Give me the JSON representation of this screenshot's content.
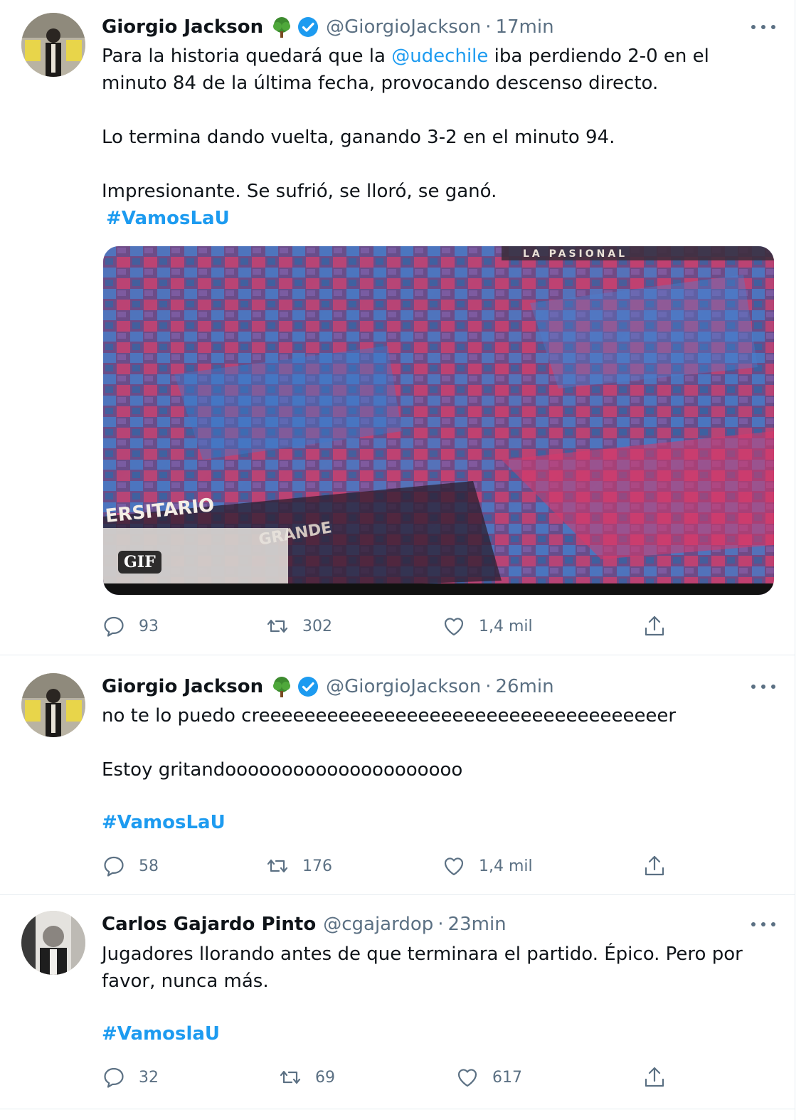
{
  "tweets": [
    {
      "author": "Giorgio Jackson",
      "handle": "@GiorgioJackson",
      "time": "17min",
      "text_parts": {
        "p1_before": "Para la historia quedará que la ",
        "p1_mention": "@udechile",
        "p1_after": " iba perdiendo 2-0 en el minuto 84 de la última fecha, provocando descenso directo.",
        "p2": "Lo termina dando vuelta, ganando 3-2 en el minuto 94.",
        "p3": "Impresionante. Se sufrió, se lloró, se ganó.",
        "hashtag": "#VamosLaU"
      },
      "media": {
        "badge": "GIF",
        "banner_left": "ERSITARIO",
        "banner_center": "GRANDE",
        "banner_top": "LA PASIONAL"
      },
      "stats": {
        "replies": "93",
        "retweets": "302",
        "likes": "1,4 mil"
      }
    },
    {
      "author": "Giorgio Jackson",
      "handle": "@GiorgioJackson",
      "time": "26min",
      "text_parts": {
        "p1": "no te lo puedo creeeeeeeeeeeeeeeeeeeeeeeeeeeeeeeeeeeer",
        "p2": "Estoy gritandooooooooooooooooooooo",
        "hashtag": "#VamosLaU"
      },
      "stats": {
        "replies": "58",
        "retweets": "176",
        "likes": "1,4 mil"
      }
    },
    {
      "author": "Carlos Gajardo Pinto",
      "handle": "@cgajardop",
      "time": "23min",
      "text_parts": {
        "p1": "Jugadores llorando antes de que terminara el partido. Épico. Pero por favor, nunca más.",
        "hashtag": "#VamoslaU"
      },
      "stats": {
        "replies": "32",
        "retweets": "69",
        "likes": "617"
      }
    }
  ],
  "separator": "·",
  "icons": [
    "reply-icon",
    "retweet-icon",
    "like-icon",
    "share-icon",
    "more-icon",
    "verified-badge-icon",
    "tree-emoji-icon"
  ],
  "colors": {
    "link": "#1d9bf0",
    "secondary_text": "#5b7083",
    "verified": "#1d9bf0"
  }
}
